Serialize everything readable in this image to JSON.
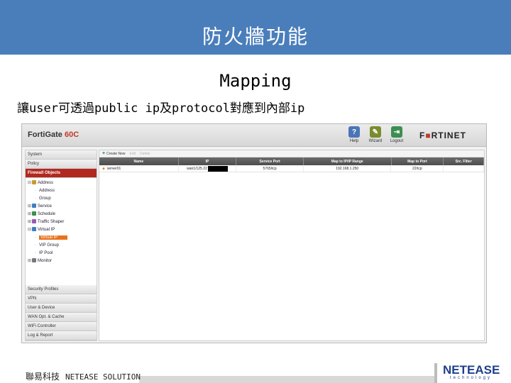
{
  "slide": {
    "title": "防火牆功能",
    "subtitle": "Mapping",
    "body": "讓user可透過public ip及protocol對應到內部ip"
  },
  "fortigate": {
    "brand": "FortiGate ",
    "model": "60C",
    "logo_left": "F",
    "logo_mark": "■",
    "logo_right": "RTINET",
    "tools": [
      {
        "label": "Help",
        "icon": "?"
      },
      {
        "label": "Wizard",
        "icon": "✎"
      },
      {
        "label": "Logout",
        "icon": "⇥"
      }
    ],
    "nav_top": [
      "System",
      "Policy",
      "Firewall Objects"
    ],
    "tree": [
      {
        "label": "Address",
        "toggle": "⊟",
        "color": "#c89b2c"
      },
      {
        "label": "Address",
        "toggle": "·",
        "color": ""
      },
      {
        "label": "Group",
        "toggle": "·",
        "color": ""
      },
      {
        "label": "Service",
        "toggle": "⊞",
        "color": "#3d7fc1"
      },
      {
        "label": "Schedule",
        "toggle": "⊞",
        "color": "#3d8f4f"
      },
      {
        "label": "Traffic Shaper",
        "toggle": "⊞",
        "color": "#9b59b6"
      },
      {
        "label": "Virtual IP",
        "toggle": "⊟",
        "color": "#3d7fc1"
      },
      {
        "label": "Virtual IP",
        "toggle": "·",
        "color": ""
      },
      {
        "label": "VIP Group",
        "toggle": "·",
        "color": ""
      },
      {
        "label": "IP Pool",
        "toggle": "·",
        "color": ""
      },
      {
        "label": "Monitor",
        "toggle": "⊞",
        "color": "#777777"
      }
    ],
    "nav_bottom": [
      "Security Profiles",
      "VPN",
      "User & Device",
      "WAN Opt. & Cache",
      "WiFi Controller",
      "Log & Report"
    ],
    "toolbar": {
      "create": "Create New",
      "edit": "Edit",
      "delete": "Delete"
    },
    "columns": [
      "Name",
      "IP",
      "Service Port",
      "Map to IP/IP Range",
      "Map to Port",
      "Src. Filter"
    ],
    "rows": [
      {
        "name": "server01",
        "ip": "wan1/125.22",
        "service_port": "5765/tcp",
        "map_ip": "192.168.1.250",
        "map_port": "22/tcp",
        "src_filter": ""
      }
    ]
  },
  "footer": {
    "company_zh": "聯易科技",
    "company_en": "NETEASE SOLUTION",
    "logo": "NETEASE",
    "logo_sub": "technology"
  }
}
